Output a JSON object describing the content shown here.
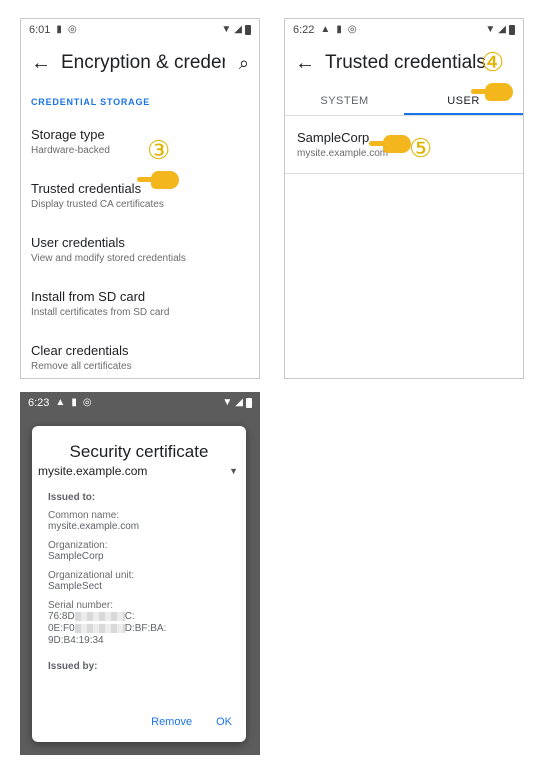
{
  "panel1": {
    "status": {
      "time": "6:01"
    },
    "appbar": {
      "title": "Encryption & creden…"
    },
    "section_header": "CREDENTIAL STORAGE",
    "items": [
      {
        "title": "Storage type",
        "subtitle": "Hardware-backed"
      },
      {
        "title": "Trusted credentials",
        "subtitle": "Display trusted CA certificates"
      },
      {
        "title": "User credentials",
        "subtitle": "View and modify stored credentials"
      },
      {
        "title": "Install from SD card",
        "subtitle": "Install certificates from SD card"
      },
      {
        "title": "Clear credentials",
        "subtitle": "Remove all certificates"
      }
    ],
    "step_marker": "③"
  },
  "panel2": {
    "status": {
      "time": "6:22"
    },
    "appbar": {
      "title": "Trusted credentials"
    },
    "tabs": [
      {
        "label": "SYSTEM",
        "active": false
      },
      {
        "label": "USER",
        "active": true
      }
    ],
    "items": [
      {
        "title": "SampleCorp",
        "subtitle": "mysite.example.com"
      }
    ],
    "step_marker_tab": "④",
    "step_marker_item": "⑤"
  },
  "panel3": {
    "status": {
      "time": "6:23"
    },
    "dialog": {
      "title": "Security certificate",
      "selected_domain": "mysite.example.com",
      "issued_to_heading": "Issued to:",
      "common_name_label": "Common name:",
      "common_name_value": "mysite.example.com",
      "organization_label": "Organization:",
      "organization_value": "SampleCorp",
      "org_unit_label": "Organizational unit:",
      "org_unit_value": "SampleSect",
      "serial_label": "Serial number:",
      "serial_line1_start": "76:8D",
      "serial_line1_end": "C:",
      "serial_line2_start": "0E:F0",
      "serial_line2_end": "D:BF:BA:",
      "serial_line3": "9D:B4:19:34",
      "issued_by_heading": "Issued by:",
      "remove_label": "Remove",
      "ok_label": "OK"
    }
  },
  "colors": {
    "accent": "#1a73e8",
    "marker": "#e0b400",
    "hand": "#f3b61c"
  }
}
